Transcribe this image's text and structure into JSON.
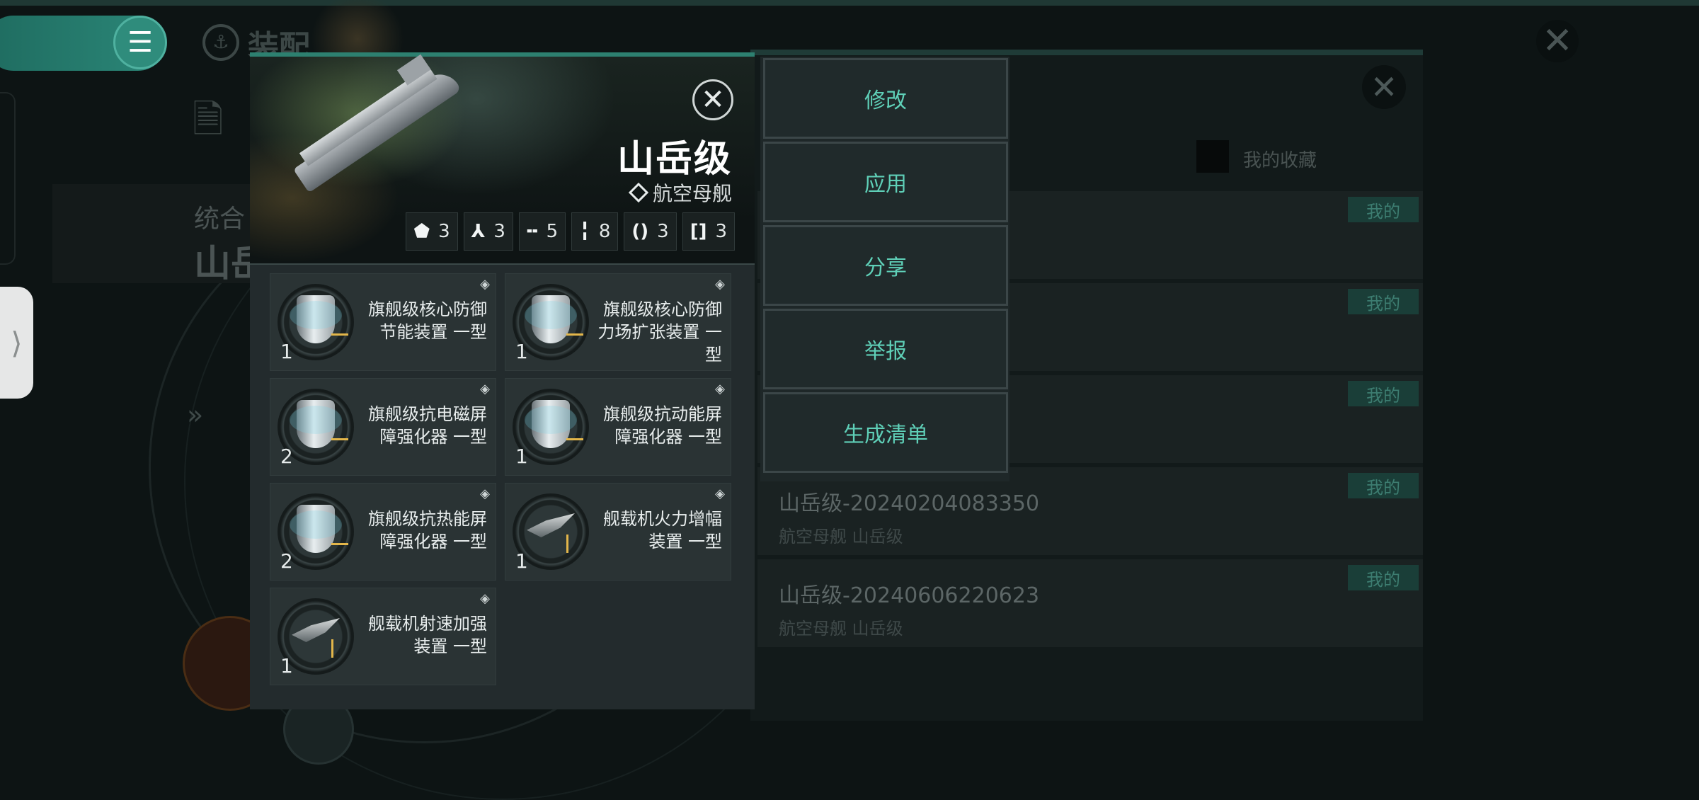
{
  "header": {
    "menu_icon": "hamburger-icon",
    "title": "装配",
    "title_icon": "anchor-icon",
    "close_icon": "close-icon"
  },
  "left_panel": {
    "label": "统合",
    "ship_short": "山岳"
  },
  "side_tab": {
    "icon": "chevron-right-icon",
    "glyph": "⟩"
  },
  "list_window": {
    "favorite_label": "我的收藏",
    "items": [
      {
        "tag": "我的",
        "name": "",
        "sub": ""
      },
      {
        "tag": "我的",
        "name": "",
        "sub": ""
      },
      {
        "tag": "我的",
        "name": "",
        "sub": ""
      },
      {
        "tag": "我的",
        "name": "山岳级-20240204083350",
        "sub": "航空母舰 山岳级"
      },
      {
        "tag": "我的",
        "name": "山岳级-20240606220623",
        "sub": "航空母舰 山岳级"
      }
    ]
  },
  "ship_card": {
    "name": "山岳级",
    "class": "航空母舰",
    "stats": [
      {
        "icon": "turret-icon",
        "glyph": "⬟",
        "value": "3"
      },
      {
        "icon": "drone-icon",
        "glyph": "⅄",
        "value": "3"
      },
      {
        "icon": "high-slot-icon",
        "glyph": "╍",
        "value": "5"
      },
      {
        "icon": "mid-slot-icon",
        "glyph": "╏",
        "value": "8"
      },
      {
        "icon": "low-slot-icon",
        "glyph": "()",
        "value": "3"
      },
      {
        "icon": "rig-slot-icon",
        "glyph": "[]",
        "value": "3"
      }
    ],
    "modules": [
      {
        "name": "旗舰级核心防御节能装置 一型",
        "count": "1",
        "icon": "shield-module-icon"
      },
      {
        "name": "旗舰级核心防御力场扩张装置 一型",
        "count": "1",
        "icon": "shield-module-icon"
      },
      {
        "name": "旗舰级抗电磁屏障强化器 一型",
        "count": "2",
        "icon": "shield-module-icon"
      },
      {
        "name": "旗舰级抗动能屏障强化器 一型",
        "count": "1",
        "icon": "shield-module-icon"
      },
      {
        "name": "旗舰级抗热能屏障强化器 一型",
        "count": "2",
        "icon": "shield-module-icon"
      },
      {
        "name": "舰载机火力增幅装置 一型",
        "count": "1",
        "icon": "fighter-module-icon"
      },
      {
        "name": "舰载机射速加强装置 一型",
        "count": "1",
        "icon": "fighter-module-icon"
      }
    ]
  },
  "actions": [
    "修改",
    "应用",
    "分享",
    "举报",
    "生成清单"
  ],
  "colors": {
    "accent": "#5fd0b8",
    "header_teal": "#2d8070",
    "tag_bg": "#1a3e38"
  }
}
